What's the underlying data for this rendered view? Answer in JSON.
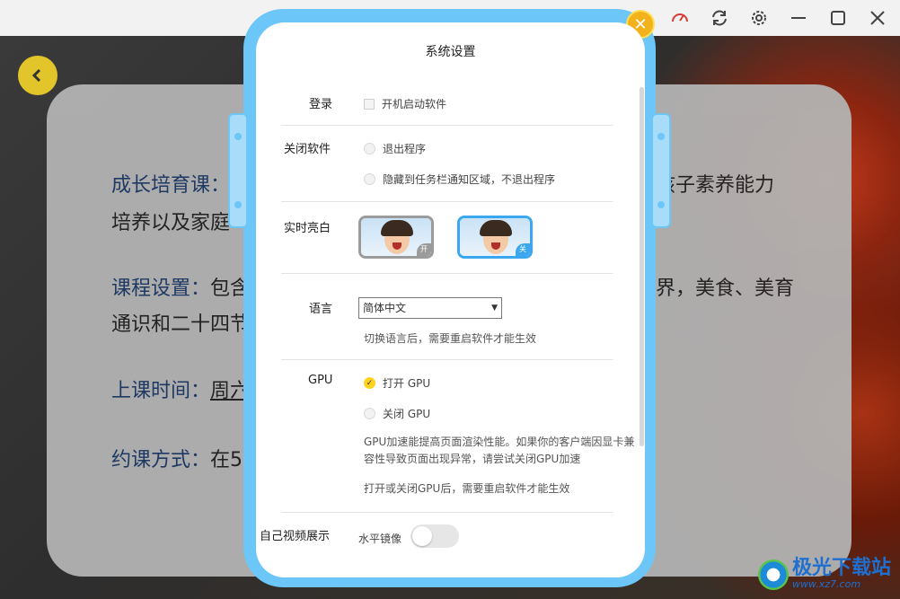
{
  "background": {
    "card_lines": [
      {
        "head": "成长培育课：",
        "rest": ""
      },
      {
        "head": "",
        "rest": "培养以及家庭"
      },
      {
        "head": "课程设置：",
        "rest": "包含"
      },
      {
        "head": "",
        "rest": "通识和二十四节"
      },
      {
        "head": "上课时间：",
        "rest": "周六"
      },
      {
        "head": "约课方式：",
        "rest": "在5"
      }
    ],
    "card_right": [
      "孩子素养能力",
      "界，美食、美育"
    ]
  },
  "watermark": {
    "title": "极光下载站",
    "url": "www.xz7.com"
  },
  "dialog": {
    "title": "系统设置",
    "login": {
      "label": "登录",
      "autostart": "开机启动软件"
    },
    "close_software": {
      "label": "关闭软件",
      "exit": "退出程序",
      "minimize": "隐藏到任务栏通知区域，不退出程序"
    },
    "brightness": {
      "label": "实时亮白",
      "on_tag": "开",
      "off_tag": "关"
    },
    "language": {
      "label": "语言",
      "value": "简体中文",
      "note": "切换语言后，需要重启软件才能生效"
    },
    "gpu": {
      "label": "GPU",
      "on": "打开 GPU",
      "off": "关闭 GPU",
      "note1": "GPU加速能提高页面渲染性能。如果你的客户端因显卡兼容性导致页面出现异常，请尝试关闭GPU加速",
      "note2": "打开或关闭GPU后，需要重启软件才能生效"
    },
    "video": {
      "label": "自己视频展示",
      "mirror": "水平镜像"
    }
  }
}
